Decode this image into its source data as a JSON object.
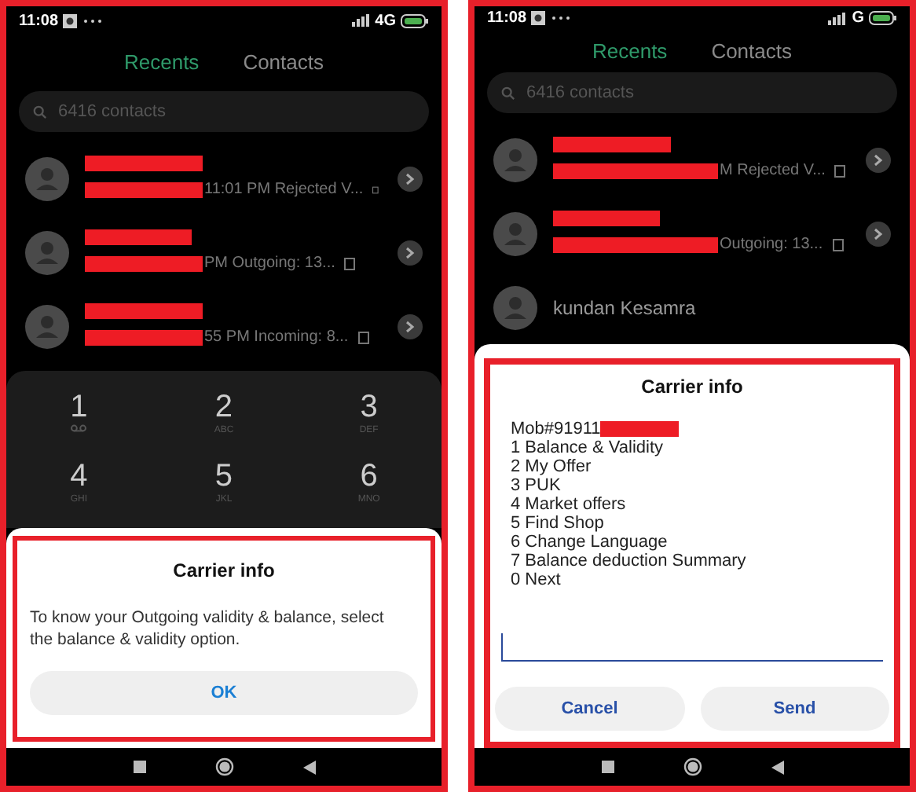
{
  "phones": [
    {
      "status": {
        "time": "11:08",
        "network": "4G"
      },
      "tabs": [
        {
          "label": "Recents",
          "selected": true
        },
        {
          "label": "Contacts",
          "selected": false
        }
      ],
      "search": {
        "placeholder": "6416 contacts"
      },
      "calls": [
        {
          "name_redacted": true,
          "detail": "11:01 PM Rejected V..."
        },
        {
          "name_redacted": true,
          "detail": "PM Outgoing: 13..."
        },
        {
          "name_redacted": true,
          "detail": "55 PM Incoming: 8..."
        }
      ],
      "keypad": [
        {
          "kind": "voicemail",
          "digit": "1"
        },
        {
          "kind": "letters",
          "digit": "2",
          "letters": "ABC"
        },
        {
          "kind": "letters",
          "digit": "3",
          "letters": "DEF"
        },
        {
          "kind": "letters",
          "digit": "4",
          "letters": "GHI"
        },
        {
          "kind": "letters",
          "digit": "5",
          "letters": "JKL"
        },
        {
          "kind": "letters",
          "digit": "6",
          "letters": "MNO"
        }
      ],
      "dialog": {
        "kind": "message",
        "title": "Carrier info",
        "message": "To know your Outgoing validity & balance, select the balance & validity option.",
        "buttons": [
          "OK"
        ]
      }
    },
    {
      "status": {
        "time": "11:08",
        "network": "G"
      },
      "tabs": [
        {
          "label": "Recents",
          "selected": true
        },
        {
          "label": "Contacts",
          "selected": false
        }
      ],
      "search": {
        "placeholder": "6416 contacts"
      },
      "calls": [
        {
          "name_redacted": true,
          "detail": "M Rejected V..."
        },
        {
          "name_redacted": true,
          "detail": "Outgoing: 13..."
        },
        {
          "name_redacted": false,
          "name": "kundan Kesamra"
        }
      ],
      "dialog": {
        "kind": "ussd",
        "title": "Carrier info",
        "header": "Mob#91911",
        "options": [
          "1 Balance & Validity",
          "2 My Offer",
          "3 PUK",
          "4 Market offers",
          "5 Find Shop",
          "6 Change Language",
          "7 Balance deduction Summary",
          "0 Next"
        ],
        "buttons": [
          "Cancel",
          "Send"
        ]
      }
    }
  ]
}
